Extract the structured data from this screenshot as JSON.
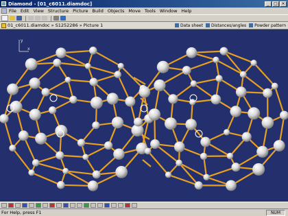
{
  "window": {
    "title": "Diamond - [01_c6011.diamdoc]"
  },
  "menu": [
    "File",
    "Edit",
    "View",
    "Structure",
    "Picture",
    "Build",
    "Objects",
    "Move",
    "Tools",
    "Window",
    "Help"
  ],
  "pathbar": {
    "crumbs": [
      "01_c6011.diamdoc",
      "S1252286",
      "Picture 1"
    ],
    "links": [
      "Data sheet",
      "Distances/angles",
      "Powder pattern"
    ]
  },
  "axes": {
    "x": "x",
    "y": "y"
  },
  "status": {
    "help": "For Help, press F1",
    "num": "NUM"
  },
  "colors": {
    "background": "#24306e",
    "bond": "#e8a020",
    "atom": "#e0e0e0"
  }
}
